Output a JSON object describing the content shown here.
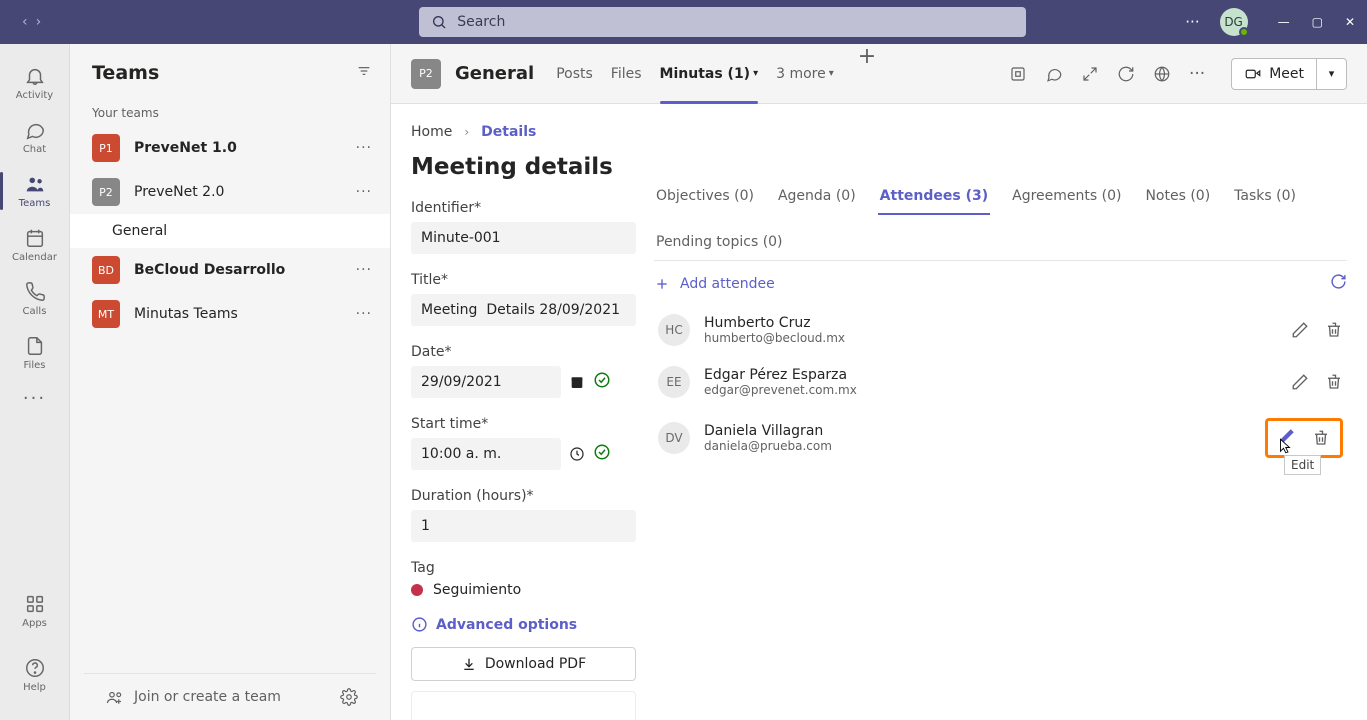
{
  "titlebar": {
    "search_placeholder": "Search",
    "avatar_initials": "DG"
  },
  "rail": {
    "items": [
      {
        "label": "Activity",
        "icon": "bell"
      },
      {
        "label": "Chat",
        "icon": "chat"
      },
      {
        "label": "Teams",
        "icon": "teams",
        "active": true
      },
      {
        "label": "Calendar",
        "icon": "calendar"
      },
      {
        "label": "Calls",
        "icon": "phone"
      },
      {
        "label": "Files",
        "icon": "file"
      }
    ],
    "apps_label": "Apps",
    "help_label": "Help"
  },
  "teams_panel": {
    "title": "Teams",
    "section": "Your teams",
    "teams": [
      {
        "initials": "P1",
        "name": "PreveNet 1.0",
        "color": "red",
        "bold": true
      },
      {
        "initials": "P2",
        "name": "PreveNet 2.0",
        "color": "grey",
        "bold": false,
        "channels": [
          {
            "name": "General",
            "selected": true
          }
        ]
      },
      {
        "initials": "BD",
        "name": "BeCloud Desarrollo",
        "color": "red",
        "bold": true
      },
      {
        "initials": "MT",
        "name": "Minutas Teams",
        "color": "red",
        "bold": false
      }
    ],
    "footer_link": "Join or create a team"
  },
  "channel_bar": {
    "icon_initials": "P2",
    "name": "General",
    "tabs": [
      {
        "label": "Posts"
      },
      {
        "label": "Files"
      },
      {
        "label": "Minutas (1)",
        "active": true,
        "has_chevron": true
      }
    ],
    "more_label": "3 more",
    "meet_label": "Meet"
  },
  "breadcrumb": {
    "home": "Home",
    "current": "Details"
  },
  "page_title": "Meeting details",
  "form": {
    "identifier_label": "Identifier*",
    "identifier_value": "Minute-001",
    "title_label": "Title*",
    "title_value": "Meeting  Details 28/09/2021",
    "date_label": "Date*",
    "date_value": "29/09/2021",
    "start_label": "Start time*",
    "start_value": "10:00 a. m.",
    "duration_label": "Duration (hours)*",
    "duration_value": "1",
    "tag_label": "Tag",
    "tag_value": "Seguimiento",
    "adv_label": "Advanced options",
    "download_label": "Download PDF"
  },
  "detail_tabs": [
    {
      "label": "Objectives (0)"
    },
    {
      "label": "Agenda (0)"
    },
    {
      "label": "Attendees (3)",
      "active": true
    },
    {
      "label": "Agreements (0)"
    },
    {
      "label": "Notes (0)"
    },
    {
      "label": "Tasks (0)"
    },
    {
      "label": "Pending topics (0)"
    }
  ],
  "add_attendee_label": "Add attendee",
  "attendees": [
    {
      "initials": "HC",
      "name": "Humberto Cruz",
      "email": "humberto@becloud.mx"
    },
    {
      "initials": "EE",
      "name": "Edgar Pérez Esparza",
      "email": "edgar@prevenet.com.mx"
    },
    {
      "initials": "DV",
      "name": "Daniela Villagran",
      "email": "daniela@prueba.com",
      "highlighted": true
    }
  ],
  "tooltip": "Edit"
}
